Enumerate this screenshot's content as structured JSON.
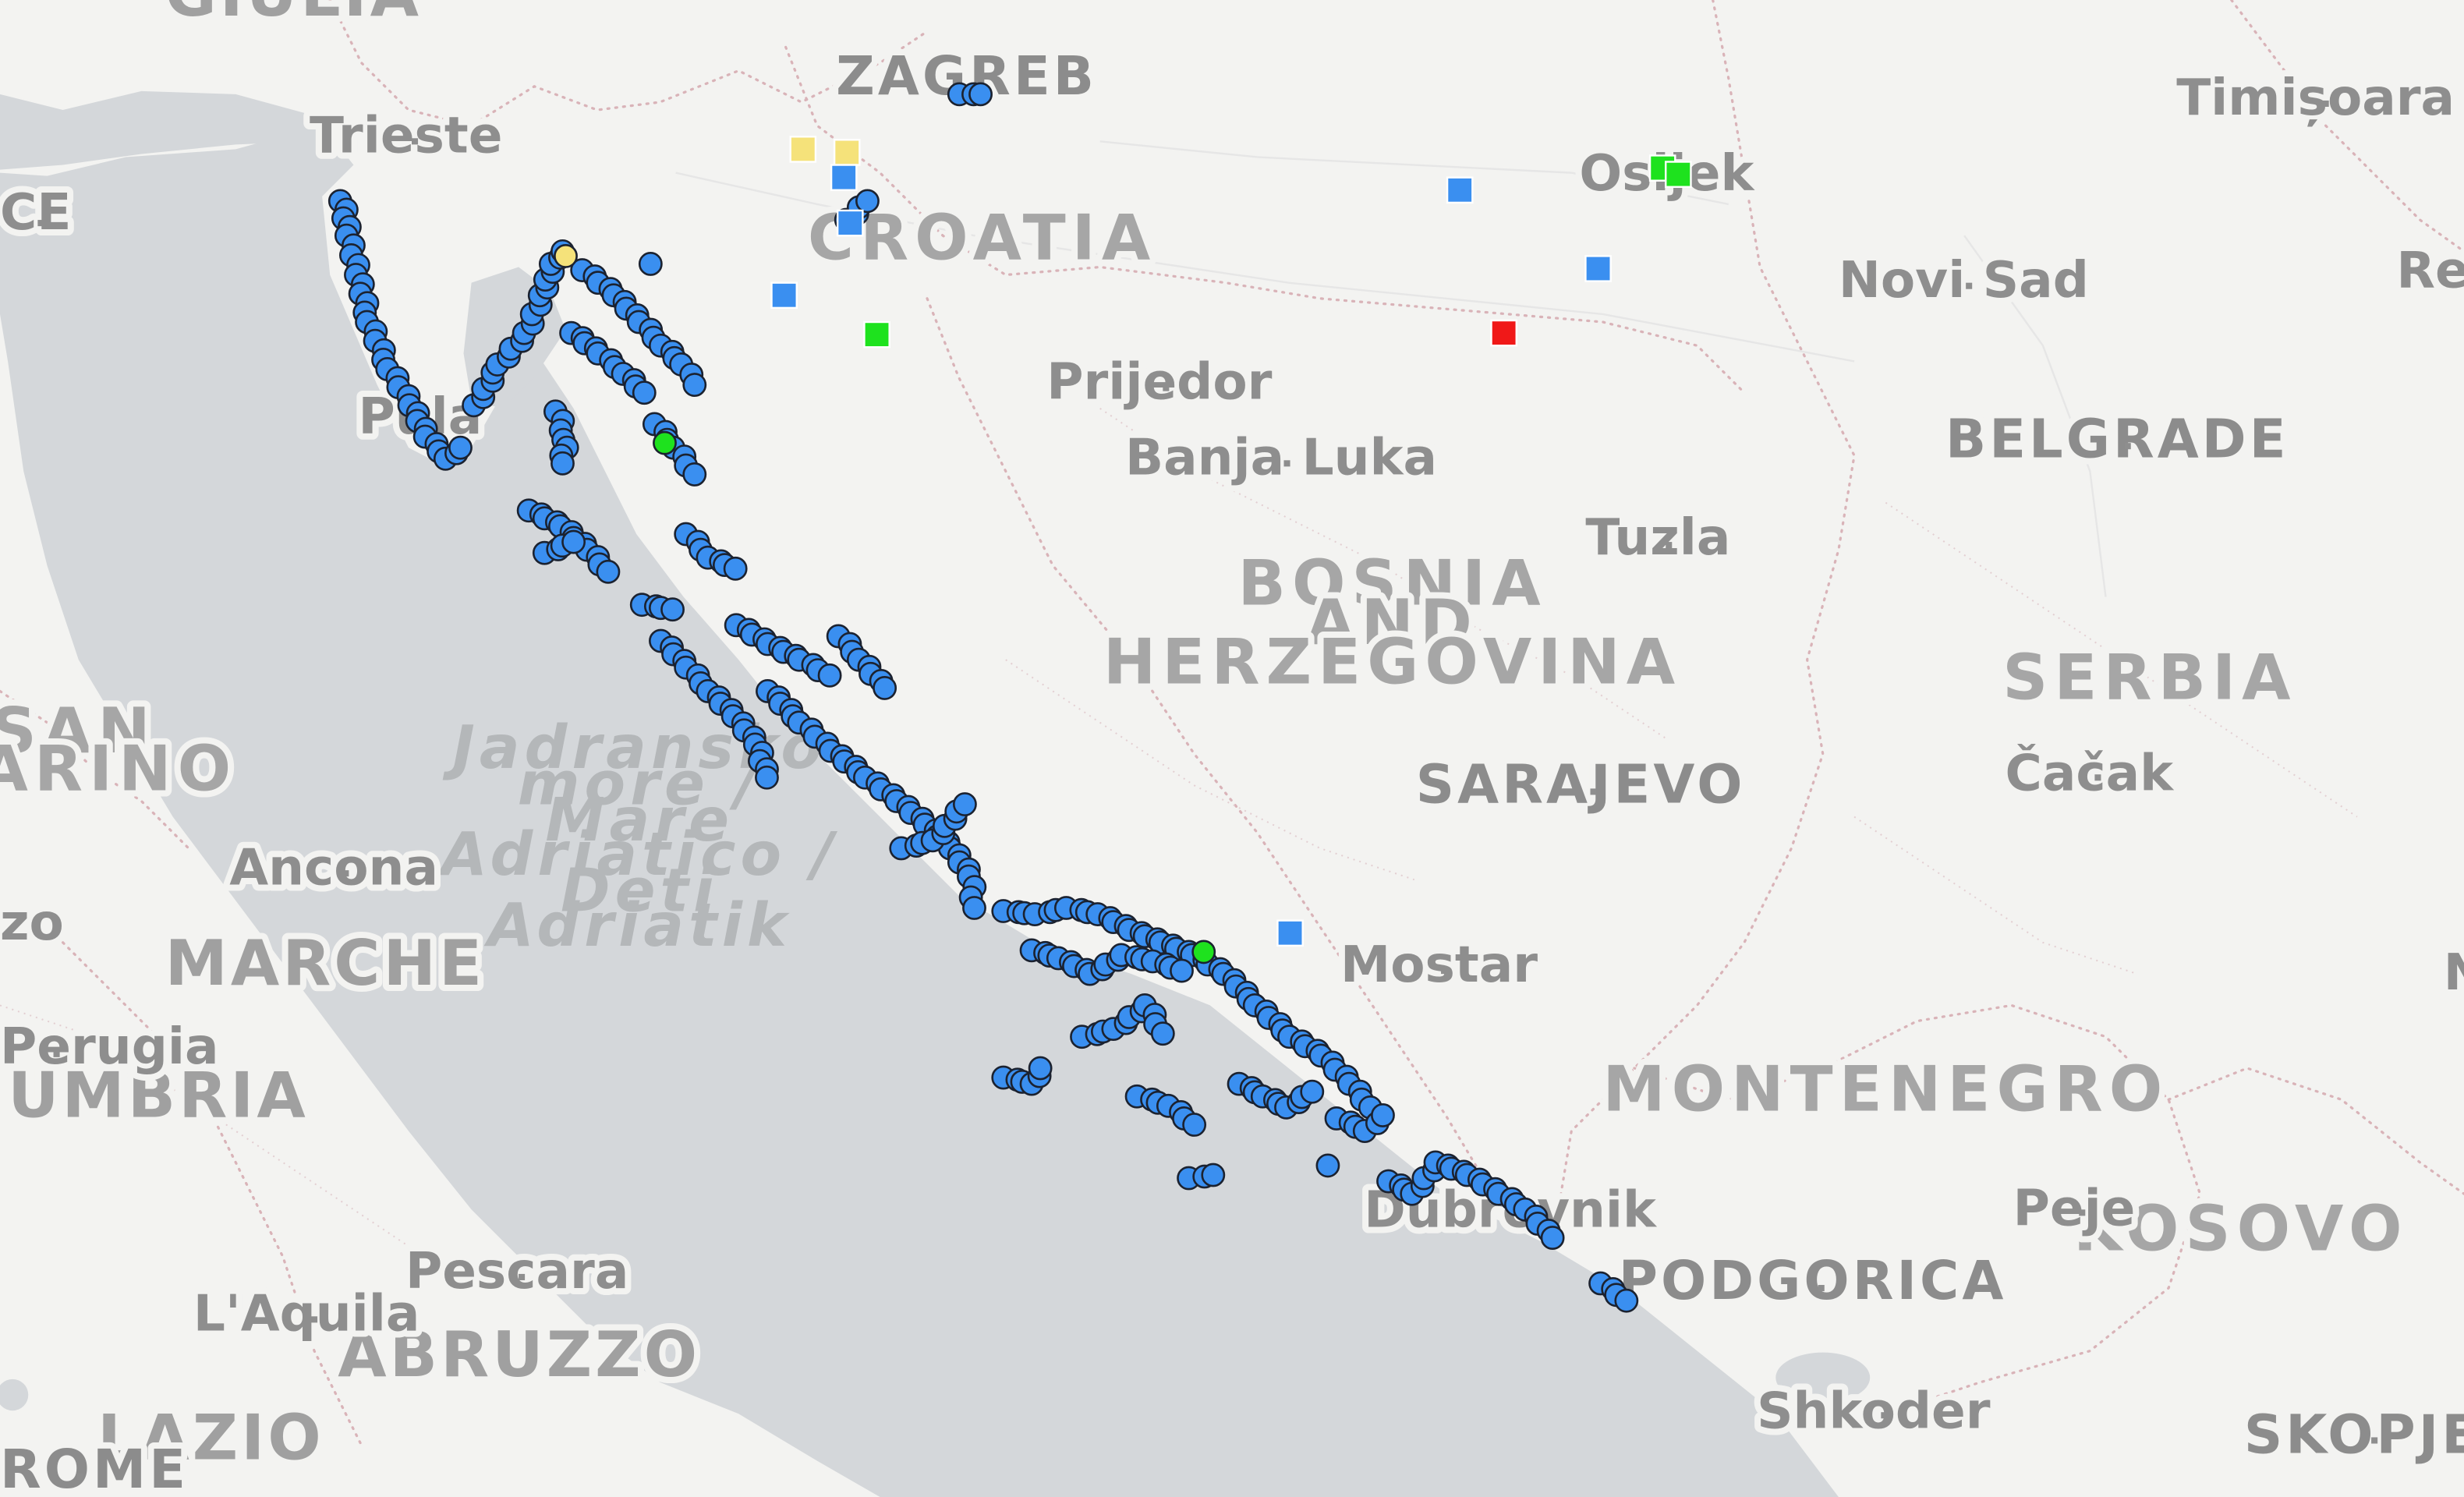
{
  "map": {
    "colors": {
      "land": "#f3f3f1",
      "sea": "#d4d7da",
      "border": "#d9b3b8",
      "marker_blue": "#3a8ff0",
      "marker_green": "#1ee21e",
      "marker_yellow": "#f5e27a",
      "marker_red": "#f01818",
      "marker_outline": "#1b2230"
    },
    "country_labels": [
      {
        "name": "country-croatia",
        "text": "CROATIA"
      },
      {
        "name": "country-bosnia-1",
        "text": "BOSNIA"
      },
      {
        "name": "country-bosnia-2",
        "text": "AND"
      },
      {
        "name": "country-bosnia-3",
        "text": "HERZEGOVINA"
      },
      {
        "name": "country-serbia",
        "text": "SERBIA"
      },
      {
        "name": "country-montenegro",
        "text": "MONTENEGRO"
      },
      {
        "name": "country-kosovo",
        "text": "KOSOVO"
      },
      {
        "name": "country-san-marino-1",
        "text": "SAN"
      },
      {
        "name": "country-san-marino-2",
        "text": "MARINO"
      }
    ],
    "region_labels": [
      {
        "name": "region-giulia",
        "text": "GIULIA"
      },
      {
        "name": "region-marche",
        "text": "MARCHE"
      },
      {
        "name": "region-umbria",
        "text": "UMBRIA"
      },
      {
        "name": "region-abruzzo",
        "text": "ABRUZZO"
      },
      {
        "name": "region-lazio",
        "text": "LAZIO"
      }
    ],
    "city_labels": [
      {
        "name": "city-zagreb",
        "text": "ZAGREB"
      },
      {
        "name": "city-trieste",
        "text": "Trieste"
      },
      {
        "name": "city-osijek",
        "text": "Osijek"
      },
      {
        "name": "city-timisoara",
        "text": "Timișoara"
      },
      {
        "name": "city-resita",
        "text": "Reșiț"
      },
      {
        "name": "city-novi-sad",
        "text": "Novi Sad"
      },
      {
        "name": "city-prijedor",
        "text": "Prijedor"
      },
      {
        "name": "city-banja-luka",
        "text": "Banja Luka"
      },
      {
        "name": "city-belgrade",
        "text": "BELGRADE"
      },
      {
        "name": "city-tuzla",
        "text": "Tuzla"
      },
      {
        "name": "city-sarajevo",
        "text": "SARAJEVO"
      },
      {
        "name": "city-cacak",
        "text": "Čačak"
      },
      {
        "name": "city-ancona",
        "text": "Ancona"
      },
      {
        "name": "city-mostar",
        "text": "Mostar"
      },
      {
        "name": "city-dubrovnik",
        "text": "Dubrovnik"
      },
      {
        "name": "city-podgorica",
        "text": "PODGORICA"
      },
      {
        "name": "city-pec",
        "text": "Peje"
      },
      {
        "name": "city-pescara",
        "text": "Pescara"
      },
      {
        "name": "city-laquila",
        "text": "L'Aquila"
      },
      {
        "name": "city-shkoder",
        "text": "Shkoder"
      },
      {
        "name": "city-skopje",
        "text": "SKOPJE"
      },
      {
        "name": "city-rome",
        "text": "ROME"
      },
      {
        "name": "city-pula",
        "text": "Pula"
      },
      {
        "name": "city-perugia",
        "text": "Perugia"
      },
      {
        "name": "city-ce",
        "text": "CE"
      },
      {
        "name": "city-n",
        "text": "N"
      },
      {
        "name": "city-zo",
        "text": "zo"
      }
    ],
    "sea_label_lines": [
      "Jadransko",
      "more /",
      "Mare",
      "Adriatico /",
      "Deti",
      "Adriatik"
    ],
    "marker_legend": {
      "circle": "blue circle points along coast",
      "square_colors": [
        "blue",
        "green",
        "yellow",
        "red"
      ]
    }
  }
}
